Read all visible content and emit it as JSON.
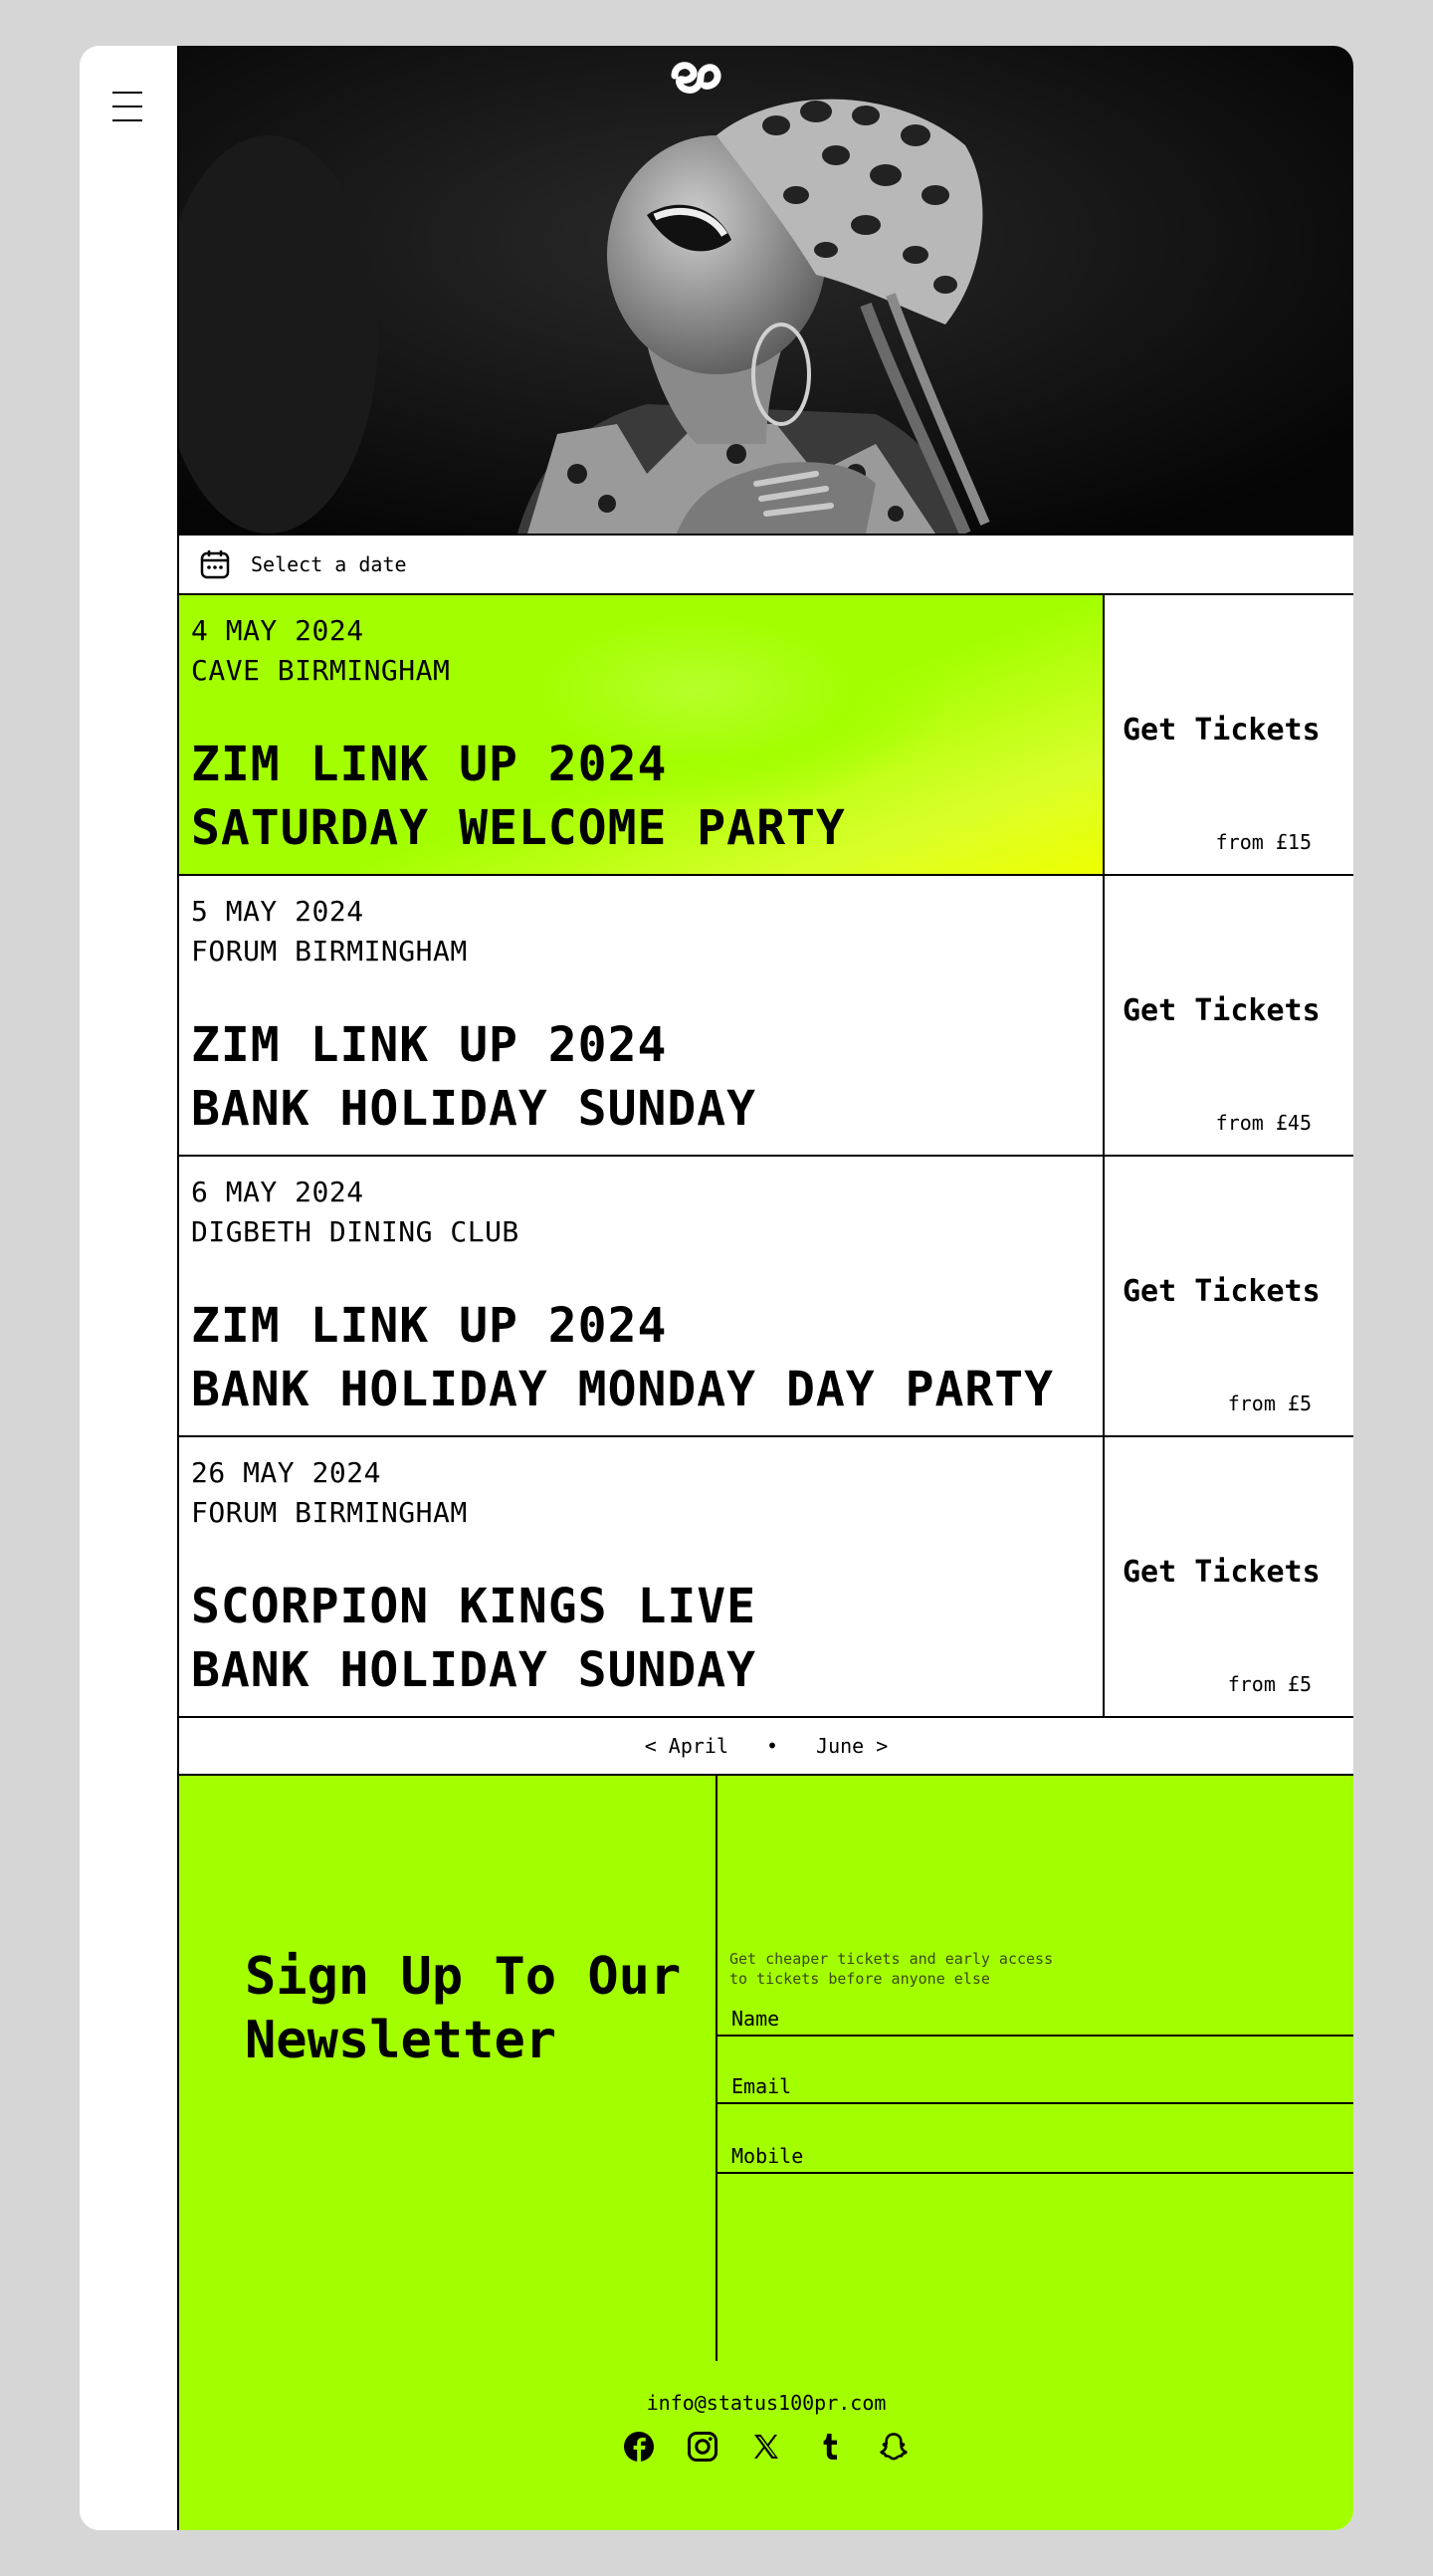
{
  "date_select": {
    "label": "Select a date"
  },
  "events": [
    {
      "date": "4 MAY 2024",
      "venue": "CAVE BIRMINGHAM",
      "title_line1": "ZIM LINK UP 2024",
      "title_line2": "SATURDAY WELCOME PARTY",
      "tickets_label": "Get Tickets",
      "price": "from £15"
    },
    {
      "date": "5 MAY 2024",
      "venue": "FORUM BIRMINGHAM",
      "title_line1": "ZIM LINK UP 2024",
      "title_line2": "BANK HOLIDAY SUNDAY",
      "tickets_label": "Get Tickets",
      "price": "from £45"
    },
    {
      "date": "6 MAY 2024",
      "venue": "DIGBETH DINING CLUB",
      "title_line1": "ZIM LINK UP 2024",
      "title_line2": "BANK HOLIDAY MONDAY DAY PARTY",
      "tickets_label": "Get Tickets",
      "price": "from £5"
    },
    {
      "date": "26 MAY 2024",
      "venue": "FORUM BIRMINGHAM",
      "title_line1": "SCORPION KINGS LIVE",
      "title_line2": "BANK HOLIDAY SUNDAY",
      "tickets_label": "Get Tickets",
      "price": "from £5"
    }
  ],
  "month_nav": {
    "prev": "< April",
    "separator": "•",
    "next": "June >"
  },
  "newsletter": {
    "heading_line1": "Sign Up To Our",
    "heading_line2": "Newsletter",
    "blurb_line1": "Get cheaper tickets and early access",
    "blurb_line2": "to tickets before anyone else",
    "fields": {
      "name": "Name",
      "email": "Email",
      "mobile": "Mobile"
    }
  },
  "footer": {
    "email": "info@status100pr.com"
  },
  "colors": {
    "accent": "#a3ff00",
    "highlight_yellow": "#eeff00",
    "border": "#000000",
    "page_bg": "#d6d6d6"
  },
  "icons": [
    "menu-icon",
    "logo-icon",
    "calendar-icon",
    "facebook-icon",
    "instagram-icon",
    "x-icon",
    "tumblr-icon",
    "snapchat-icon"
  ]
}
